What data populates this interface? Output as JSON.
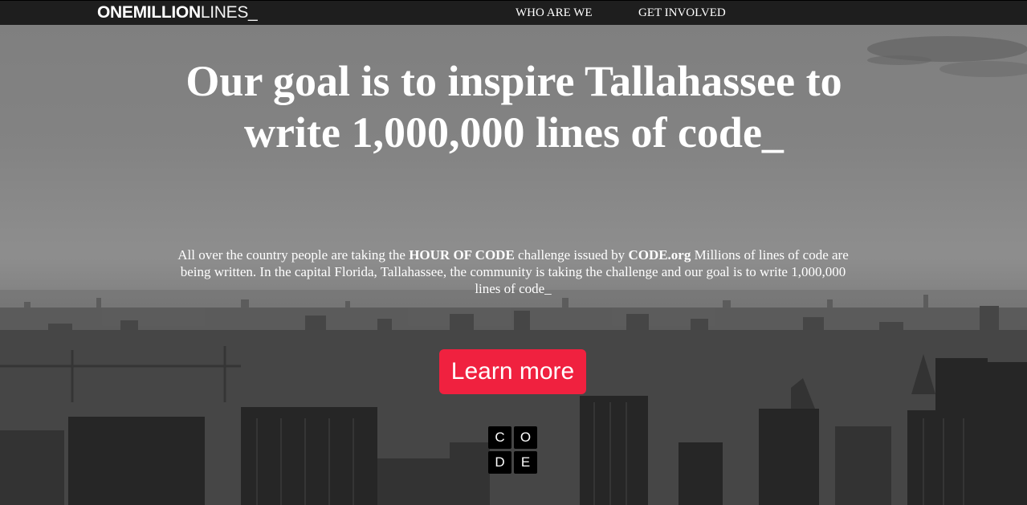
{
  "navbar": {
    "brand_bold": "ONEMILLION",
    "brand_thin": "LINES_",
    "links": [
      "WHO ARE WE",
      "GET INVOLVED"
    ]
  },
  "hero": {
    "headline": "Our goal is to inspire Tallahassee to write 1,000,000 lines of code_",
    "intro": {
      "part1": "All over the country people are taking the ",
      "strong1": "HOUR OF CODE",
      "part2": " challenge issued by ",
      "strong2": "CODE.org",
      "part3": " Millions of lines of code are being written. In the capital Florida, Tallahassee, the community is taking the challenge and our goal is to write 1,000,000 lines of code_"
    },
    "cta_label": "Learn more",
    "code_logo": [
      "C",
      "O",
      "D",
      "E"
    ]
  },
  "colors": {
    "navbar_bg": "#1e1e1e",
    "cta_bg": "#f0213f",
    "text": "#ffffff"
  }
}
